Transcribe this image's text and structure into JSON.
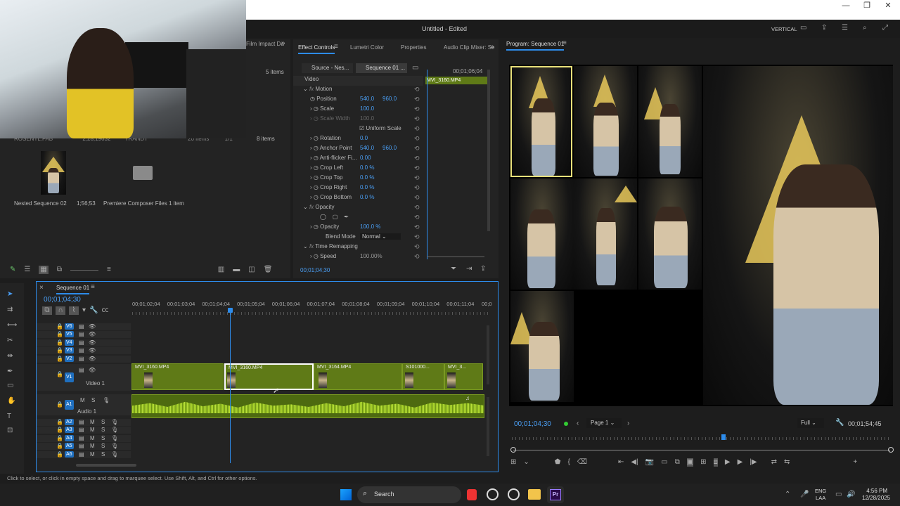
{
  "app": {
    "window_title": "Untitled - Edited",
    "vertical_label": "VERTICAL",
    "status_bar": "Click to select, or click in empty space and drag to marquee select. Use Shift, Alt, and Ctrl for other options."
  },
  "project": {
    "tab_label": "Film Impact Da",
    "item_count_top": "5 items",
    "row_partial": {
      "name": "ROSENTL.FAB",
      "duration": "2;28;19632",
      "type": "TRANDT",
      "items": "20 items",
      "extra": "1/1",
      "count": "8 items"
    },
    "items": [
      {
        "name": "Nested Sequence 02",
        "duration": "1;56;53"
      },
      {
        "name": "Premiere Composer Files",
        "count": "1 item"
      }
    ]
  },
  "effect_controls": {
    "tabs": [
      "Effect Controls",
      "Lumetri Color",
      "Properties",
      "Audio Clip Mixer: Se"
    ],
    "source_tab": "Source - Nes...",
    "sequence_tab": "Sequence 01 ...",
    "time_ruler": "00;01;06;04",
    "clip_label": "MVI_3160.MP4",
    "section_video": "Video",
    "motion": "Motion",
    "position_label": "Position",
    "position_x": "540.0",
    "position_y": "960.0",
    "scale_label": "Scale",
    "scale_val": "100.0",
    "scale_width_label": "Scale Width",
    "scale_width_val": "100.0",
    "uniform_scale": "Uniform Scale",
    "rotation_label": "Rotation",
    "rotation_val": "0.0",
    "anchor_label": "Anchor Point",
    "anchor_x": "540.0",
    "anchor_y": "960.0",
    "antiflicker_label": "Anti-flicker Fi...",
    "antiflicker_val": "0.00",
    "crop_left_label": "Crop Left",
    "crop_left_val": "0.0 %",
    "crop_top_label": "Crop Top",
    "crop_top_val": "0.0 %",
    "crop_right_label": "Crop Right",
    "crop_right_val": "0.0 %",
    "crop_bottom_label": "Crop Bottom",
    "crop_bottom_val": "0.0 %",
    "opacity_section": "Opacity",
    "opacity_label": "Opacity",
    "opacity_val": "100.0 %",
    "blend_label": "Blend Mode",
    "blend_val": "Normal",
    "time_remap": "Time Remapping",
    "speed_label": "Speed",
    "speed_val": "100.00%",
    "current_time": "00;01;04;30"
  },
  "timeline": {
    "tab_label": "Sequence 01",
    "current_time": "00;01;04;30",
    "ruler": [
      "00;01;02;04",
      "00;01;03;04",
      "00;01;04;04",
      "00;01;05;04",
      "00;01;06;04",
      "00;01;07;04",
      "00;01;08;04",
      "00;01;09;04",
      "00;01;10;04",
      "00;01;11;04",
      "00;0"
    ],
    "video_tracks": [
      "V6",
      "V5",
      "V4",
      "V3",
      "V2"
    ],
    "v1": "V1",
    "v1_name": "Video 1",
    "a1": "A1",
    "a1_name": "Audio 1",
    "audio_tracks": [
      "A2",
      "A3",
      "A4",
      "A5",
      "A6"
    ],
    "clips": [
      "MVI_3160.MP4",
      "MVI_3160.MP4",
      "MVI_3164.MP4",
      "S101000...",
      "MVI_3..."
    ]
  },
  "program": {
    "title": "Program: Sequence 01",
    "timecode": "00;01;04;30",
    "page": "Page 1",
    "fit": "Full",
    "duration": "00;01;54;45"
  },
  "taskbar": {
    "search": "Search",
    "lang1": "ENG",
    "lang2": "LAA",
    "time": "4:56 PM",
    "date": "12/28/2025"
  },
  "colors": {
    "accent": "#2d8ceb",
    "clip_green": "#5f7a17",
    "audio_green": "#9ac21f",
    "selection_yellow": "#e8e07a"
  }
}
